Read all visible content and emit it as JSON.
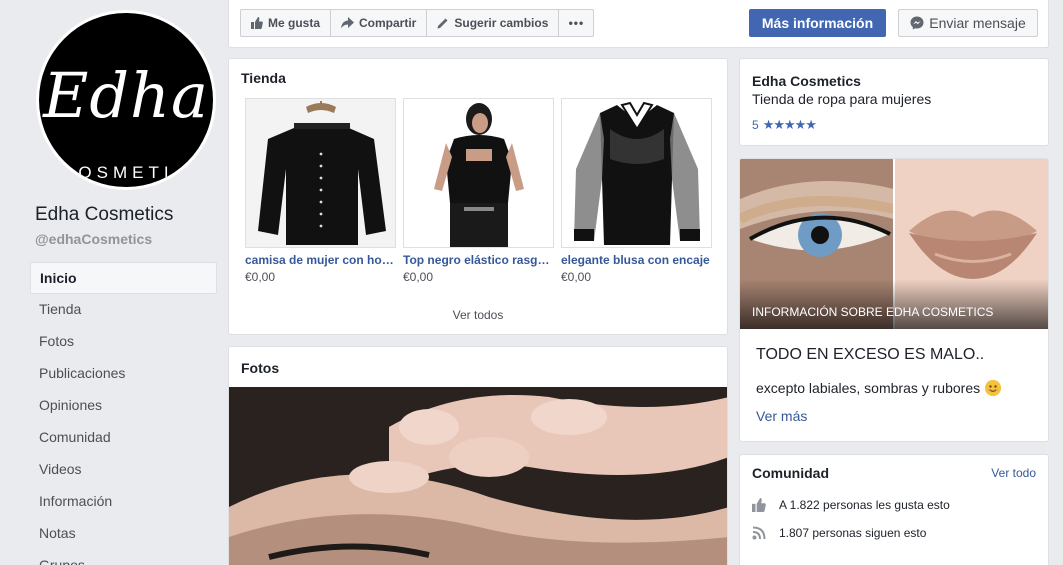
{
  "profile": {
    "logo_text": "Edha",
    "logo_sub": "OSMETI",
    "name": "Edha Cosmetics",
    "handle": "@edhaCosmetics"
  },
  "nav": {
    "items": [
      {
        "label": "Inicio",
        "active": true
      },
      {
        "label": "Tienda"
      },
      {
        "label": "Fotos"
      },
      {
        "label": "Publicaciones"
      },
      {
        "label": "Opiniones"
      },
      {
        "label": "Comunidad"
      },
      {
        "label": "Videos"
      },
      {
        "label": "Información"
      },
      {
        "label": "Notas"
      },
      {
        "label": "Grupos"
      }
    ]
  },
  "toolbar": {
    "like_label": "Me gusta",
    "share_label": "Compartir",
    "suggest_label": "Sugerir cambios",
    "more_label": "•••",
    "cta_label": "Más información",
    "message_label": "Enviar mensaje"
  },
  "shop": {
    "title": "Tienda",
    "products": [
      {
        "name": "camisa de mujer con hombros descubiertos",
        "price": "€0,00"
      },
      {
        "name": "Top negro elástico rasgado",
        "price": "€0,00"
      },
      {
        "name": "elegante blusa con encaje",
        "price": "€0,00"
      }
    ],
    "see_all": "Ver todos"
  },
  "photos": {
    "title": "Fotos"
  },
  "info": {
    "name": "Edha Cosmetics",
    "category": "Tienda de ropa para mujeres",
    "rating": "5",
    "stars": "★★★★★"
  },
  "about": {
    "label": "INFORMACIÓN SOBRE EDHA COSMETICS",
    "headline": "TODO EN EXCESO ES MALO..",
    "description": "excepto labiales, sombras y rubores",
    "see_more": "Ver más"
  },
  "community": {
    "title": "Comunidad",
    "see_all": "Ver todo",
    "likes": "A 1.822 personas les gusta esto",
    "followers": "1.807 personas siguen esto"
  },
  "colors": {
    "brand_blue": "#4267b2",
    "link_blue": "#365899",
    "background": "#e9ebee"
  }
}
